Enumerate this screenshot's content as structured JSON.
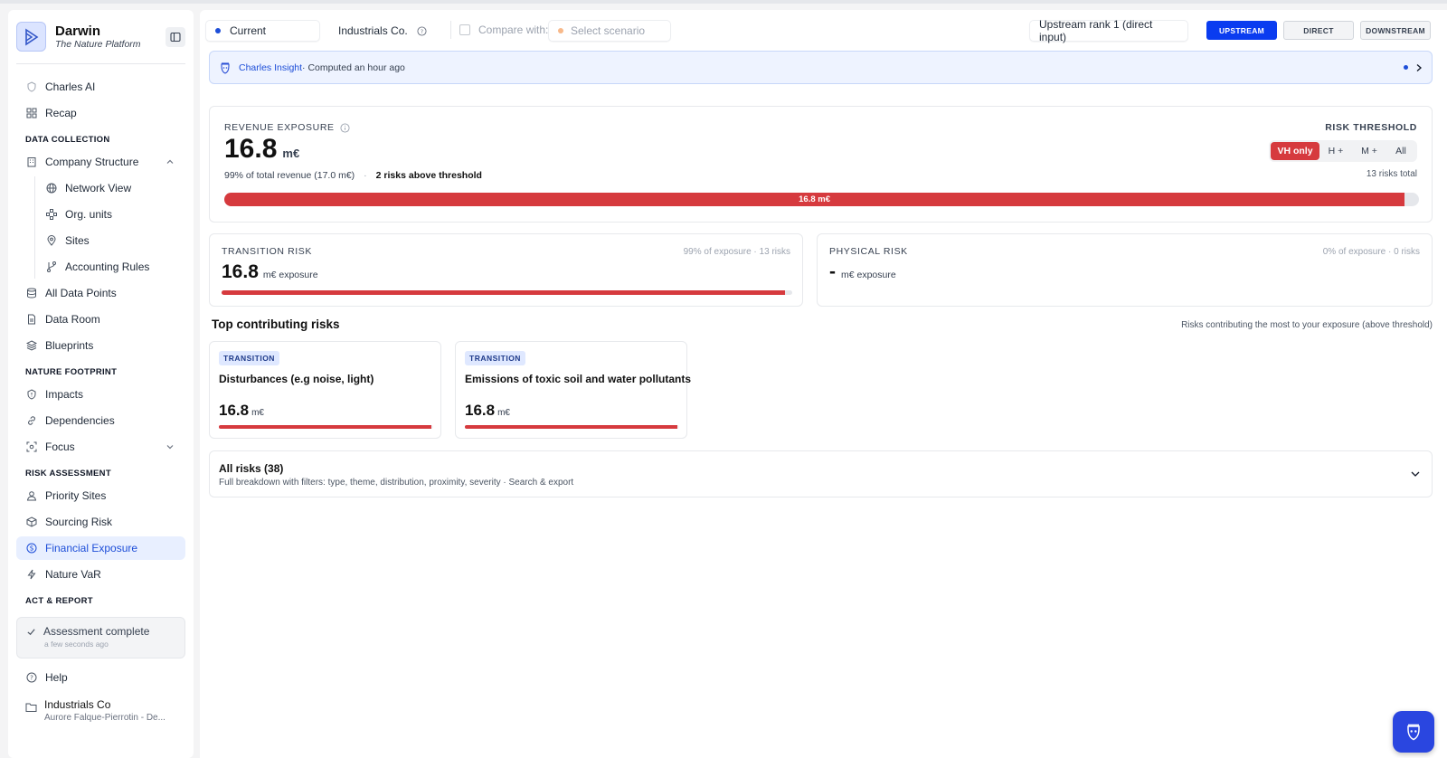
{
  "brand": {
    "name": "Darwin",
    "subtitle": "The Nature Platform"
  },
  "nav": {
    "charles_ai": "Charles AI",
    "recap": "Recap",
    "sections": {
      "data_collection": "DATA COLLECTION",
      "nature_footprint": "NATURE FOOTPRINT",
      "risk_assessment": "RISK ASSESSMENT",
      "act_report": "ACT & REPORT"
    },
    "company_structure": "Company Structure",
    "network_view": "Network View",
    "org_units": "Org. units",
    "sites": "Sites",
    "accounting_rules": "Accounting Rules",
    "all_data_points": "All Data Points",
    "data_room": "Data Room",
    "blueprints": "Blueprints",
    "impacts": "Impacts",
    "dependencies": "Dependencies",
    "focus": "Focus",
    "priority_sites": "Priority Sites",
    "sourcing_risk": "Sourcing Risk",
    "financial_exposure": "Financial Exposure",
    "nature_var": "Nature VaR"
  },
  "assessment": {
    "title": "Assessment complete",
    "time": "a few seconds ago"
  },
  "help": "Help",
  "org": {
    "name": "Industrials Co",
    "user": "Aurore Falque-Pierrotin - De..."
  },
  "topbar": {
    "current": "Current",
    "company": "Industrials Co.",
    "compare_label": "Compare with:",
    "scenario_placeholder": "Select scenario",
    "rank": "Upstream rank 1 (direct input)",
    "modes": [
      "UPSTREAM",
      "DIRECT",
      "DOWNSTREAM"
    ]
  },
  "insight": {
    "title": "Charles Insight",
    "meta": " · Computed an hour ago"
  },
  "revenue": {
    "label": "REVENUE EXPOSURE",
    "value": "16.8",
    "unit": "m€",
    "pct_text": "99% of total revenue (17.0 m€)",
    "sep": "·",
    "risks_above": "2 risks above threshold",
    "bar_label": "16.8 m€",
    "bar_fraction": 0.988
  },
  "threshold": {
    "label": "RISK THRESHOLD",
    "options": [
      "VH only",
      "H +",
      "M +",
      "All"
    ],
    "total": "13 risks total"
  },
  "transition": {
    "label": "TRANSITION RISK",
    "meta": "99% of exposure · 13 risks",
    "value": "16.8",
    "unit": "m€ exposure",
    "bar_fraction": 0.988
  },
  "physical": {
    "label": "PHYSICAL RISK",
    "meta": "0% of exposure · 0 risks",
    "value": "-",
    "unit": "m€ exposure"
  },
  "top": {
    "title": "Top contributing risks",
    "subtitle": "Risks contributing the most to your exposure (above threshold)",
    "cards": [
      {
        "tag": "TRANSITION",
        "name": "Disturbances (e.g noise, light)",
        "value": "16.8",
        "unit": "m€",
        "bar_fraction": 0.99
      },
      {
        "tag": "TRANSITION",
        "name": "Emissions of toxic soil and water pollutants",
        "value": "16.8",
        "unit": "m€",
        "bar_fraction": 0.99
      }
    ]
  },
  "all_risks": {
    "title": "All risks (38)",
    "subtitle": "Full breakdown with filters: type, theme, distribution, proximity, severity · Search & export"
  },
  "colors": {
    "accent": "#1d4ed8",
    "danger": "#d63a3e",
    "primary_btn": "#0a3cf0"
  }
}
